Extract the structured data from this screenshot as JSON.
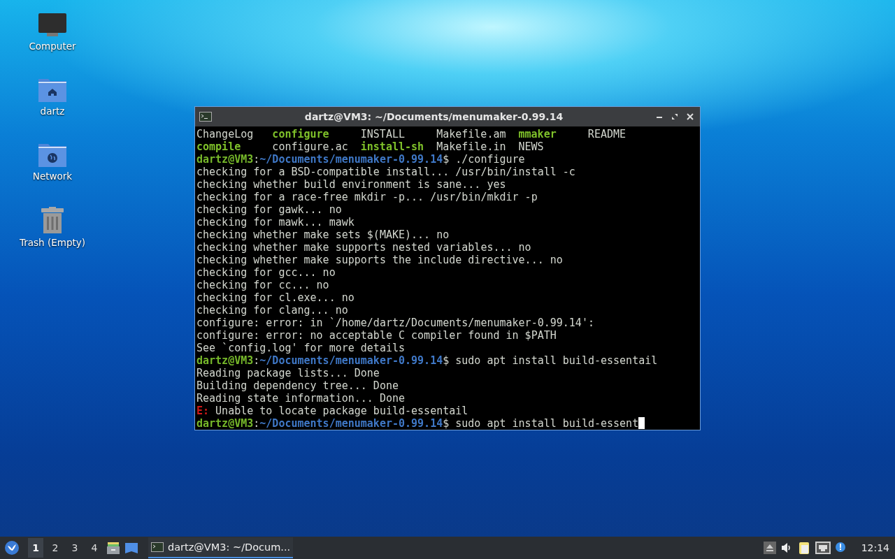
{
  "desktop_icons": [
    {
      "kind": "computer",
      "label": "Computer"
    },
    {
      "kind": "home",
      "label": "dartz"
    },
    {
      "kind": "network",
      "label": "Network"
    },
    {
      "kind": "trash",
      "label": "Trash (Empty)"
    }
  ],
  "terminal": {
    "title": "dartz@VM3: ~/Documents/menumaker-0.99.14",
    "ls_rows": [
      [
        {
          "text": "ChangeLog",
          "kind": "file"
        },
        {
          "text": "configure",
          "kind": "exec"
        },
        {
          "text": "INSTALL",
          "kind": "file"
        },
        {
          "text": "Makefile.am",
          "kind": "file"
        },
        {
          "text": "mmaker",
          "kind": "exec"
        },
        {
          "text": "README",
          "kind": "file"
        }
      ],
      [
        {
          "text": "compile",
          "kind": "exec"
        },
        {
          "text": "configure.ac",
          "kind": "file"
        },
        {
          "text": "install-sh",
          "kind": "exec"
        },
        {
          "text": "Makefile.in",
          "kind": "file"
        },
        {
          "text": "NEWS",
          "kind": "file"
        }
      ]
    ],
    "lines": [
      {
        "kind": "prompt",
        "user": "dartz@VM3",
        "sep": ":",
        "path": "~/Documents/menumaker-0.99.14",
        "command": "$ ./configure",
        "cursor": false
      },
      {
        "kind": "output",
        "text": "checking for a BSD-compatible install... /usr/bin/install -c"
      },
      {
        "kind": "output",
        "text": "checking whether build environment is sane... yes"
      },
      {
        "kind": "output",
        "text": "checking for a race-free mkdir -p... /usr/bin/mkdir -p"
      },
      {
        "kind": "output",
        "text": "checking for gawk... no"
      },
      {
        "kind": "output",
        "text": "checking for mawk... mawk"
      },
      {
        "kind": "output",
        "text": "checking whether make sets $(MAKE)... no"
      },
      {
        "kind": "output",
        "text": "checking whether make supports nested variables... no"
      },
      {
        "kind": "output",
        "text": "checking whether make supports the include directive... no"
      },
      {
        "kind": "output",
        "text": "checking for gcc... no"
      },
      {
        "kind": "output",
        "text": "checking for cc... no"
      },
      {
        "kind": "output",
        "text": "checking for cl.exe... no"
      },
      {
        "kind": "output",
        "text": "checking for clang... no"
      },
      {
        "kind": "output",
        "text": "configure: error: in `/home/dartz/Documents/menumaker-0.99.14':"
      },
      {
        "kind": "output",
        "text": "configure: error: no acceptable C compiler found in $PATH"
      },
      {
        "kind": "output",
        "text": "See `config.log' for more details"
      },
      {
        "kind": "prompt",
        "user": "dartz@VM3",
        "sep": ":",
        "path": "~/Documents/menumaker-0.99.14",
        "command": "$ sudo apt install build-essentail",
        "cursor": false
      },
      {
        "kind": "output",
        "text": "Reading package lists... Done"
      },
      {
        "kind": "output",
        "text": "Building dependency tree... Done"
      },
      {
        "kind": "output",
        "text": "Reading state information... Done"
      },
      {
        "kind": "error",
        "tag": "E:",
        "text": " Unable to locate package build-essentail"
      },
      {
        "kind": "prompt",
        "user": "dartz@VM3",
        "sep": ":",
        "path": "~/Documents/menumaker-0.99.14",
        "command": "$ sudo apt install build-essent",
        "cursor": true
      }
    ]
  },
  "taskbar": {
    "workspaces": [
      {
        "label": "1",
        "selected": true
      },
      {
        "label": "2",
        "selected": false
      },
      {
        "label": "3",
        "selected": false
      },
      {
        "label": "4",
        "selected": false
      }
    ],
    "tasks": [
      {
        "label": "dartz@VM3: ~/Docum...",
        "selected": true
      }
    ],
    "clock": "12:14"
  }
}
